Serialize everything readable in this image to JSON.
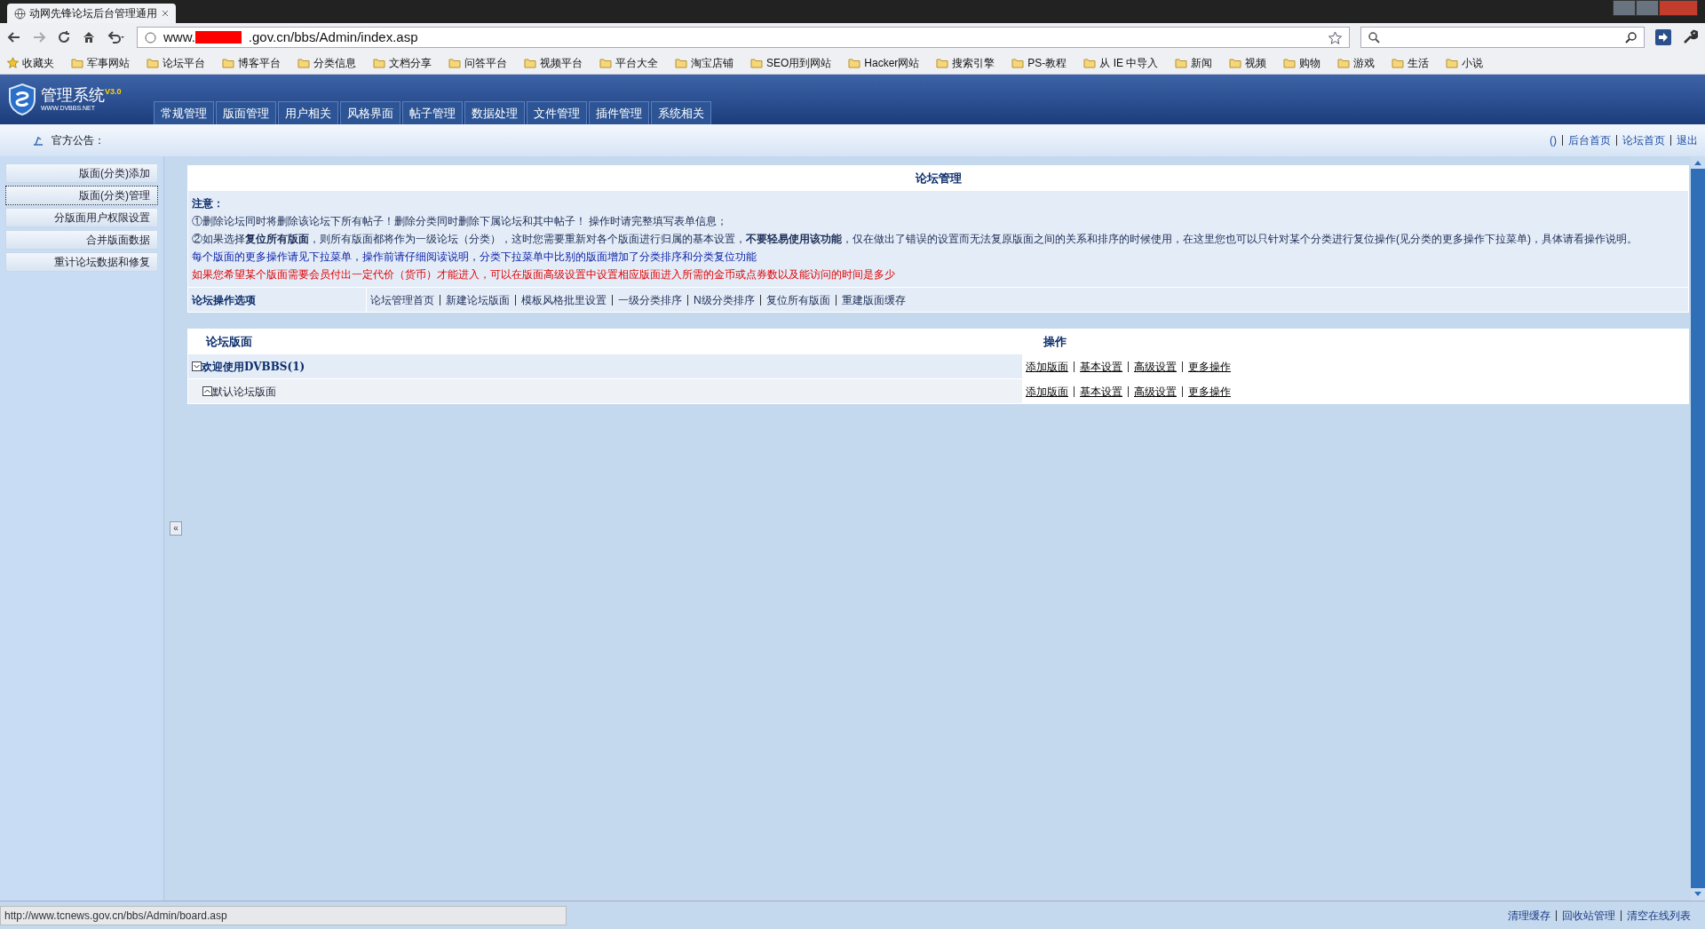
{
  "browser": {
    "tab_title": "动网先锋论坛后台管理通用",
    "url_prefix": "www.",
    "url_rest": ".gov.cn/bbs/Admin/index.asp",
    "bookmarks": [
      "收藏夹",
      "军事网站",
      "论坛平台",
      "博客平台",
      "分类信息",
      "文档分享",
      "问答平台",
      "视频平台",
      "平台大全",
      "淘宝店铺",
      "SEO用到网站",
      "Hacker网站",
      "搜索引擎",
      "PS-教程",
      "从 IE 中导入",
      "新闻",
      "视频",
      "购物",
      "游戏",
      "生活",
      "小说"
    ]
  },
  "header": {
    "logo_title": "管理系统",
    "version": "V3.0",
    "logo_sub": "WWW.DVBBS.NET",
    "nav": [
      "常规管理",
      "版面管理",
      "用户相关",
      "风格界面",
      "帖子管理",
      "数据处理",
      "文件管理",
      "插件管理",
      "系统相关"
    ]
  },
  "notice_bar": {
    "label": "官方公告：",
    "links": [
      "()",
      "后台首页",
      "论坛首页",
      "退出"
    ]
  },
  "sidebar": {
    "items": [
      {
        "label": "版面(分类)添加",
        "selected": false
      },
      {
        "label": "版面(分类)管理",
        "selected": true
      },
      {
        "label": "分版面用户权限设置",
        "selected": false
      },
      {
        "label": "合并版面数据",
        "selected": false
      },
      {
        "label": "重计论坛数据和修复",
        "selected": false
      }
    ],
    "collapse": "«"
  },
  "panel": {
    "title": "论坛管理",
    "notes_heading": "注意：",
    "notes": [
      {
        "kind": "normal",
        "text": "①删除论坛同时将删除该论坛下所有帖子！删除分类同时删除下属论坛和其中帖子！ 操作时请完整填写表单信息；"
      },
      {
        "kind": "normal",
        "text": "②如果选择**复位所有版面**，则所有版面都将作为一级论坛（分类），这时您需要重新对各个版面进行归属的基本设置，**不要轻易使用该功能**，仅在做出了错误的设置而无法复原版面之间的关系和排序的时候使用，在这里您也可以只针对某个分类进行复位操作(见分类的更多操作下拉菜单)，具体请看操作说明。"
      },
      {
        "kind": "info",
        "text": "每个版面的更多操作请见下拉菜单，操作前请仔细阅读说明，分类下拉菜单中比别的版面增加了分类排序和分类复位功能"
      },
      {
        "kind": "warning",
        "text": "如果您希望某个版面需要会员付出一定代价（货币）才能进入，可以在版面高级设置中设置相应版面进入所需的金币或点券数以及能访问的时间是多少"
      }
    ],
    "options_label": "论坛操作选项",
    "options": [
      "论坛管理首页",
      "新建论坛版面",
      "模板风格批里设置",
      "一级分类排序",
      "N级分类排序",
      "复位所有版面",
      "重建版面缓存"
    ]
  },
  "table": {
    "columns": [
      "论坛版面",
      "操作"
    ],
    "rows": [
      {
        "name": "欢迎使用DVBBS(1)",
        "expanded": true,
        "actions": [
          "添加版面",
          "基本设置",
          "高级设置",
          "更多操作"
        ],
        "children": [
          {
            "name": "默认论坛版面",
            "expanded": false,
            "actions": [
              "添加版面",
              "基本设置",
              "高级设置",
              "更多操作"
            ]
          }
        ]
      }
    ]
  },
  "status_bar": {
    "url": "http://www.tcnews.gov.cn/bbs/Admin/board.asp",
    "links": [
      "清理缓存",
      "回收站管理",
      "清空在线列表"
    ]
  }
}
